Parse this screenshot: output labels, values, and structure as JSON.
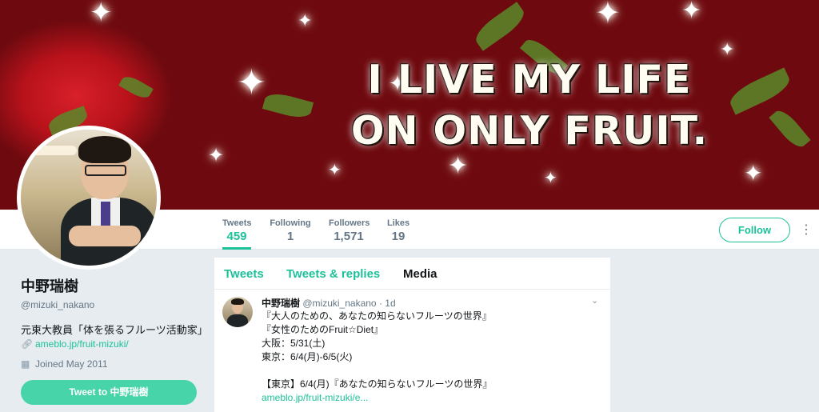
{
  "banner": {
    "line1": "I LIVE MY LIFE",
    "line2": "ON ONLY FRUIT."
  },
  "profile": {
    "name": "中野瑞樹",
    "handle": "@mizuki_nakano",
    "bio": "元東大教員「体を張るフルーツ活動家」",
    "link": "ameblo.jp/fruit-mizuki/",
    "joined": "Joined May 2011",
    "tweet_to_label": "Tweet to 中野瑞樹"
  },
  "stats": [
    {
      "label": "Tweets",
      "value": "459"
    },
    {
      "label": "Following",
      "value": "1"
    },
    {
      "label": "Followers",
      "value": "1,571"
    },
    {
      "label": "Likes",
      "value": "19"
    }
  ],
  "actions": {
    "follow_label": "Follow",
    "more_icon": "⋮"
  },
  "tabs": [
    {
      "label": "Tweets"
    },
    {
      "label": "Tweets & replies"
    },
    {
      "label": "Media"
    }
  ],
  "tweet": {
    "name": "中野瑞樹",
    "handle": "@mizuki_nakano",
    "time": "· 1d",
    "lines": [
      "『大人のための、あなたの知らないフルーツの世界』",
      "『女性のためのFruit☆Diet』",
      "大阪：5/31(土)",
      "東京：6/4(月)-6/5(火)",
      "",
      "【東京】6/4(月)『あなたの知らないフルーツの世界』"
    ],
    "link": "ameblo.jp/fruit-mizuki/e..."
  },
  "colors": {
    "accent": "#1dc199",
    "tweet_to_button": "#47d4a8",
    "background": "#e6ecf0"
  }
}
